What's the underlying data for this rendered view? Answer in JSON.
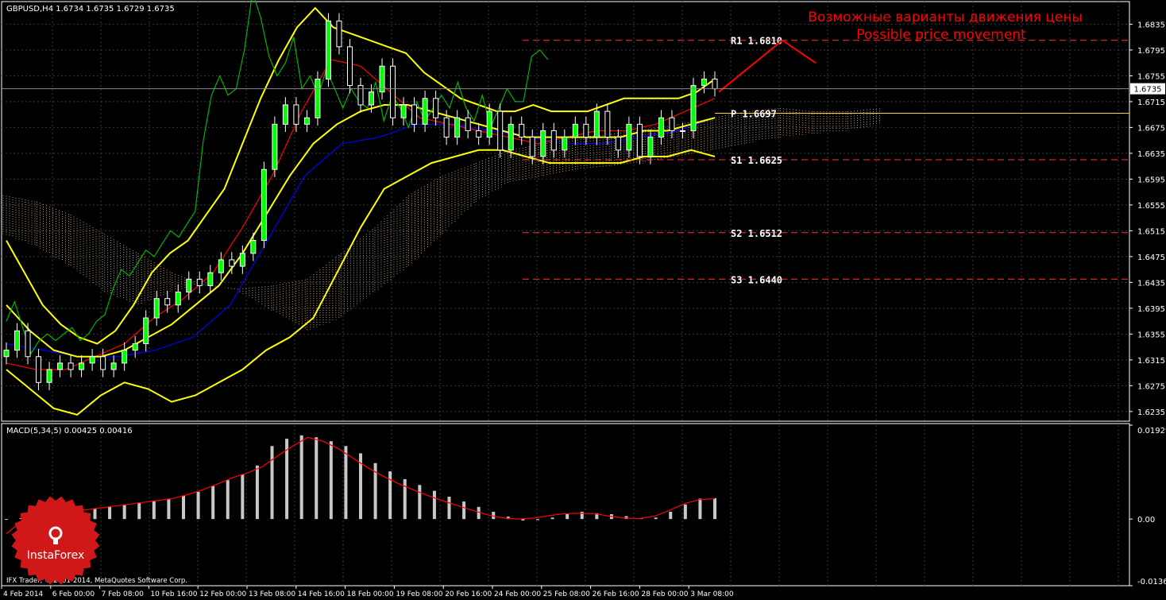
{
  "header": {
    "symbol_line": "GBPUSD,H4  1.6734 1.6735 1.6729 1.6735",
    "title_ru": "Возможные варианты движения цены",
    "title_en": "Possible price movement"
  },
  "macd_header": "MACD(5,34,5) 0.00425 0.00416",
  "watermark": "IFX Trader, © 2001-2014, MetaQuotes Software Corp.",
  "logo_text": "InstaForex",
  "colors": {
    "background": "#000000",
    "grid": "#3a3a3a",
    "axis": "#ffffff",
    "bull": "#00ff00",
    "bear": "#ffffff",
    "bollinger": "#ffff00",
    "tenkan": "#ff0000",
    "kijun": "#0000ff",
    "chikou": "#00b400",
    "kumo": "#ffd9a0",
    "macd_hist": "#c8c8c8",
    "macd_signal": "#ff0000",
    "pivot_line": "#ff3333",
    "title_red": "#ff0000",
    "logo_red": "#d01818"
  },
  "chart_data": [
    {
      "type": "candlestick",
      "symbol": "GBPUSD",
      "timeframe": "H4",
      "ylim": [
        1.622,
        1.687
      ],
      "y_ticks": [
        "1.6835",
        "1.6795",
        "1.6755",
        "1.6715",
        "1.6675",
        "1.6635",
        "1.6595",
        "1.6555",
        "1.6515",
        "1.6475",
        "1.6435",
        "1.6395",
        "1.6355",
        "1.6315",
        "1.6275",
        "1.6235"
      ],
      "current_price_label": "1.6735",
      "x_ticks": [
        "4 Feb 2014",
        "6 Feb 00:00",
        "7 Feb 08:00",
        "10 Feb 16:00",
        "12 Feb 00:00",
        "13 Feb 08:00",
        "14 Feb 16:00",
        "18 Feb 00:00",
        "19 Feb 08:00",
        "20 Feb 16:00",
        "24 Feb 00:00",
        "25 Feb 08:00",
        "26 Feb 16:00",
        "28 Feb 00:00",
        "3 Mar 08:00"
      ],
      "close": [
        1.633,
        1.636,
        1.632,
        1.628,
        1.63,
        1.631,
        1.63,
        1.631,
        1.632,
        1.63,
        1.631,
        1.633,
        1.634,
        1.638,
        1.641,
        1.64,
        1.642,
        1.644,
        1.643,
        1.645,
        1.647,
        1.646,
        1.648,
        1.65,
        1.661,
        1.668,
        1.671,
        1.668,
        1.669,
        1.675,
        1.684,
        1.68,
        1.674,
        1.671,
        1.673,
        1.677,
        1.669,
        1.671,
        1.668,
        1.672,
        1.669,
        1.666,
        1.669,
        1.667,
        1.666,
        1.67,
        1.664,
        1.668,
        1.666,
        1.663,
        1.667,
        1.664,
        1.666,
        1.668,
        1.666,
        1.67,
        1.666,
        1.664,
        1.668,
        1.663,
        1.666,
        1.669,
        1.667,
        1.667,
        1.674,
        1.675,
        1.6735
      ],
      "bollinger_upper": [
        1.65,
        1.645,
        1.64,
        1.637,
        1.635,
        1.634,
        1.636,
        1.64,
        1.645,
        1.648,
        1.65,
        1.654,
        1.658,
        1.665,
        1.672,
        1.678,
        1.683,
        1.686,
        1.683,
        1.682,
        1.681,
        1.68,
        1.679,
        1.676,
        1.674,
        1.672,
        1.671,
        1.67,
        1.67,
        1.671,
        1.67,
        1.67,
        1.67,
        1.671,
        1.672,
        1.672,
        1.672,
        1.672,
        1.673,
        1.675
      ],
      "bollinger_middle": [
        1.64,
        1.636,
        1.633,
        1.632,
        1.632,
        1.633,
        1.635,
        1.637,
        1.64,
        1.643,
        1.648,
        1.654,
        1.66,
        1.665,
        1.668,
        1.67,
        1.671,
        1.671,
        1.67,
        1.669,
        1.668,
        1.667,
        1.666,
        1.666,
        1.666,
        1.666,
        1.666,
        1.667,
        1.667,
        1.668,
        1.669
      ],
      "bollinger_lower": [
        1.63,
        1.627,
        1.624,
        1.623,
        1.626,
        1.628,
        1.627,
        1.625,
        1.626,
        1.628,
        1.63,
        1.633,
        1.635,
        1.638,
        1.645,
        1.652,
        1.658,
        1.66,
        1.662,
        1.663,
        1.664,
        1.664,
        1.663,
        1.662,
        1.662,
        1.662,
        1.662,
        1.663,
        1.663,
        1.664,
        1.663
      ],
      "ichimoku_tenkan": [
        1.631,
        1.63,
        1.63,
        1.632,
        1.634,
        1.638,
        1.641,
        1.645,
        1.652,
        1.66,
        1.67,
        1.678,
        1.677,
        1.673,
        1.669,
        1.668,
        1.667,
        1.666,
        1.665,
        1.666,
        1.667,
        1.667,
        1.668,
        1.67,
        1.672
      ],
      "ichimoku_kijun": [
        1.634,
        1.633,
        1.632,
        1.632,
        1.633,
        1.635,
        1.64,
        1.65,
        1.66,
        1.665,
        1.666,
        1.668,
        1.668,
        1.667,
        1.666,
        1.665,
        1.665,
        1.666,
        1.667,
        1.669
      ],
      "pivot_levels": [
        {
          "label": "R1",
          "value": "1.6810"
        },
        {
          "label": "P",
          "value": "1.6697"
        },
        {
          "label": "S1",
          "value": "1.6625"
        },
        {
          "label": "S2",
          "value": "1.6512"
        },
        {
          "label": "S3",
          "value": "1.6440"
        }
      ],
      "forecast_path": [
        1.673,
        1.681,
        1.6775
      ]
    },
    {
      "type": "bar",
      "indicator": "MACD(5,34,5)",
      "ylim": [
        -0.01369,
        0.01929
      ],
      "y_ticks": [
        "0.01929",
        "0.00",
        "-0.01369"
      ],
      "histogram": [
        -0.0001,
        0.0002,
        0.0006,
        0.001,
        0.0014,
        0.0018,
        0.0022,
        0.0026,
        0.003,
        0.0034,
        0.0038,
        0.0042,
        0.0048,
        0.0056,
        0.0068,
        0.008,
        0.0092,
        0.011,
        0.015,
        0.0165,
        0.0172,
        0.0168,
        0.016,
        0.015,
        0.0135,
        0.0115,
        0.0098,
        0.0082,
        0.007,
        0.0058,
        0.0046,
        0.0036,
        0.0025,
        0.0015,
        0.0005,
        -0.0003,
        -0.0002,
        0.0003,
        0.001,
        0.0015,
        0.0012,
        0.001,
        0.0006,
        0.0002,
        0.0003,
        0.0015,
        0.003,
        0.0042,
        0.0043
      ],
      "signal": [
        -0.003,
        -0.0005,
        0.0005,
        0.001,
        0.0014,
        0.0018,
        0.0022,
        0.0026,
        0.003,
        0.0034,
        0.0038,
        0.0042,
        0.005,
        0.006,
        0.0072,
        0.0085,
        0.0095,
        0.0108,
        0.013,
        0.015,
        0.0168,
        0.016,
        0.0145,
        0.0125,
        0.0105,
        0.0088,
        0.0073,
        0.006,
        0.0048,
        0.0037,
        0.0027,
        0.0017,
        0.0008,
        0.0002,
        0.0,
        0.0002,
        0.0007,
        0.0011,
        0.0012,
        0.0011,
        0.0006,
        0.0002,
        0.0001,
        0.0006,
        0.0018,
        0.0032,
        0.004,
        0.0042
      ]
    }
  ]
}
